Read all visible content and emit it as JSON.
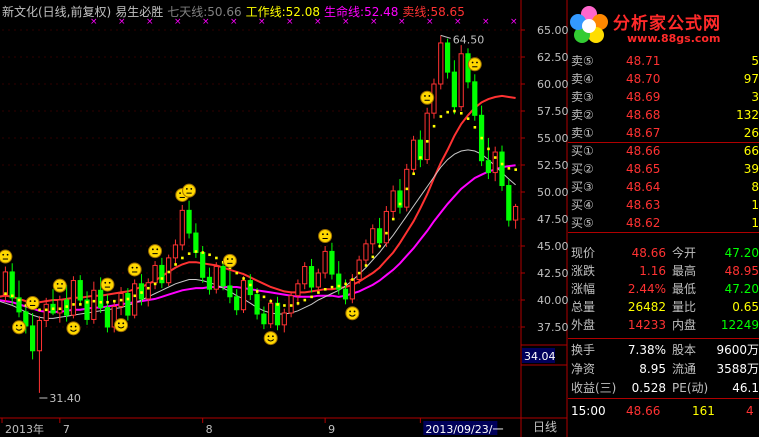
{
  "header": {
    "stock": "新文化(日线,前复权)",
    "indicator": "易生必胜",
    "qitian_label": "七天线:",
    "qitian_value": "50.66",
    "gongzuo_label": "工作线:",
    "gongzuo_value": "52.08",
    "shengming_label": "生命线:",
    "shengming_value": "52.48",
    "maixian_label": "卖线:",
    "maixian_value": "58.65"
  },
  "colors": {
    "up": "#ff3232",
    "down": "#00ff00",
    "gongzuo": "#ffffff",
    "shengming": "#ff00ff",
    "maixian": "#ff3232",
    "dots": "#ffff00",
    "axis": "#b00000"
  },
  "logo": {
    "brand": "分析家公式网",
    "url": "www.88gs.com"
  },
  "chart_data": {
    "type": "candlestick",
    "ylim": [
      34.5,
      66.0
    ],
    "y_ticks": [
      "65.00",
      "62.50",
      "60.00",
      "57.50",
      "55.00",
      "52.50",
      "50.00",
      "47.50",
      "45.00",
      "42.50",
      "40.00",
      "37.50"
    ],
    "x_labels": [
      "2013年",
      "7",
      "8",
      "9",
      "2013/09/23/一"
    ],
    "annotations": {
      "high": "64.50",
      "low": "31.40",
      "cursor_value": "34.04"
    },
    "candles": [
      {
        "o": 40.5,
        "h": 43.1,
        "l": 39.8,
        "c": 42.6
      },
      {
        "o": 42.6,
        "h": 43.4,
        "l": 39.5,
        "c": 40.2
      },
      {
        "o": 40.2,
        "h": 41.8,
        "l": 38.4,
        "c": 38.9
      },
      {
        "o": 38.9,
        "h": 39.6,
        "l": 36.9,
        "c": 37.6
      },
      {
        "o": 37.6,
        "h": 38.8,
        "l": 34.5,
        "c": 35.3
      },
      {
        "o": 35.3,
        "h": 38.5,
        "l": 31.4,
        "c": 38.1
      },
      {
        "o": 38.1,
        "h": 40.2,
        "l": 37.5,
        "c": 39.6
      },
      {
        "o": 39.6,
        "h": 41.0,
        "l": 38.6,
        "c": 38.8
      },
      {
        "o": 38.8,
        "h": 40.4,
        "l": 37.9,
        "c": 40.0
      },
      {
        "o": 40.0,
        "h": 41.4,
        "l": 38.0,
        "c": 38.6
      },
      {
        "o": 38.6,
        "h": 42.2,
        "l": 38.3,
        "c": 41.8
      },
      {
        "o": 41.8,
        "h": 42.3,
        "l": 39.6,
        "c": 40.0
      },
      {
        "o": 40.0,
        "h": 40.8,
        "l": 37.7,
        "c": 38.2
      },
      {
        "o": 38.2,
        "h": 41.7,
        "l": 37.8,
        "c": 40.9
      },
      {
        "o": 40.9,
        "h": 42.1,
        "l": 38.8,
        "c": 39.3
      },
      {
        "o": 39.3,
        "h": 40.5,
        "l": 37.0,
        "c": 37.5
      },
      {
        "o": 37.5,
        "h": 39.9,
        "l": 37.0,
        "c": 39.4
      },
      {
        "o": 39.4,
        "h": 41.2,
        "l": 38.6,
        "c": 40.6
      },
      {
        "o": 40.6,
        "h": 41.1,
        "l": 38.1,
        "c": 38.6
      },
      {
        "o": 38.6,
        "h": 41.9,
        "l": 38.3,
        "c": 41.5
      },
      {
        "o": 41.5,
        "h": 42.4,
        "l": 39.5,
        "c": 40.1
      },
      {
        "o": 40.1,
        "h": 42.0,
        "l": 39.4,
        "c": 41.6
      },
      {
        "o": 41.6,
        "h": 43.6,
        "l": 41.0,
        "c": 43.2
      },
      {
        "o": 43.2,
        "h": 43.9,
        "l": 41.1,
        "c": 41.6
      },
      {
        "o": 41.6,
        "h": 44.2,
        "l": 41.3,
        "c": 43.9
      },
      {
        "o": 43.9,
        "h": 45.6,
        "l": 43.2,
        "c": 45.1
      },
      {
        "o": 45.1,
        "h": 48.8,
        "l": 44.6,
        "c": 48.3
      },
      {
        "o": 48.3,
        "h": 49.2,
        "l": 45.7,
        "c": 46.2
      },
      {
        "o": 46.2,
        "h": 47.1,
        "l": 43.9,
        "c": 44.4
      },
      {
        "o": 44.4,
        "h": 45.0,
        "l": 41.6,
        "c": 42.1
      },
      {
        "o": 42.1,
        "h": 43.0,
        "l": 40.5,
        "c": 41.0
      },
      {
        "o": 41.0,
        "h": 43.5,
        "l": 40.6,
        "c": 43.1
      },
      {
        "o": 43.1,
        "h": 43.6,
        "l": 40.9,
        "c": 41.3
      },
      {
        "o": 41.3,
        "h": 42.7,
        "l": 39.7,
        "c": 40.3
      },
      {
        "o": 40.3,
        "h": 41.0,
        "l": 38.6,
        "c": 39.1
      },
      {
        "o": 39.1,
        "h": 42.2,
        "l": 38.8,
        "c": 41.8
      },
      {
        "o": 41.8,
        "h": 42.4,
        "l": 40.0,
        "c": 40.5
      },
      {
        "o": 40.5,
        "h": 41.1,
        "l": 38.2,
        "c": 38.7
      },
      {
        "o": 38.7,
        "h": 39.4,
        "l": 37.3,
        "c": 37.8
      },
      {
        "o": 37.8,
        "h": 40.1,
        "l": 37.4,
        "c": 39.7
      },
      {
        "o": 39.7,
        "h": 40.3,
        "l": 37.2,
        "c": 37.7
      },
      {
        "o": 37.7,
        "h": 39.2,
        "l": 37.0,
        "c": 38.8
      },
      {
        "o": 38.8,
        "h": 40.8,
        "l": 38.4,
        "c": 40.4
      },
      {
        "o": 40.4,
        "h": 41.9,
        "l": 39.5,
        "c": 41.5
      },
      {
        "o": 41.5,
        "h": 43.5,
        "l": 41.0,
        "c": 43.1
      },
      {
        "o": 43.1,
        "h": 43.8,
        "l": 40.7,
        "c": 41.2
      },
      {
        "o": 41.2,
        "h": 42.9,
        "l": 40.9,
        "c": 42.5
      },
      {
        "o": 42.5,
        "h": 45.0,
        "l": 42.0,
        "c": 44.5
      },
      {
        "o": 44.5,
        "h": 45.3,
        "l": 41.9,
        "c": 42.4
      },
      {
        "o": 42.4,
        "h": 43.6,
        "l": 40.5,
        "c": 41.0
      },
      {
        "o": 41.0,
        "h": 41.9,
        "l": 39.6,
        "c": 40.1
      },
      {
        "o": 40.1,
        "h": 42.4,
        "l": 39.7,
        "c": 41.9
      },
      {
        "o": 41.9,
        "h": 44.1,
        "l": 41.5,
        "c": 43.7
      },
      {
        "o": 43.7,
        "h": 45.6,
        "l": 43.1,
        "c": 45.2
      },
      {
        "o": 45.2,
        "h": 47.0,
        "l": 44.3,
        "c": 46.6
      },
      {
        "o": 46.6,
        "h": 47.6,
        "l": 44.8,
        "c": 45.3
      },
      {
        "o": 45.3,
        "h": 48.7,
        "l": 44.9,
        "c": 48.2
      },
      {
        "o": 48.2,
        "h": 50.6,
        "l": 47.6,
        "c": 50.1
      },
      {
        "o": 50.1,
        "h": 51.2,
        "l": 48.0,
        "c": 48.6
      },
      {
        "o": 48.6,
        "h": 52.6,
        "l": 48.2,
        "c": 52.1
      },
      {
        "o": 52.1,
        "h": 55.2,
        "l": 51.6,
        "c": 54.8
      },
      {
        "o": 54.8,
        "h": 55.7,
        "l": 52.3,
        "c": 53.0
      },
      {
        "o": 53.0,
        "h": 57.8,
        "l": 52.6,
        "c": 57.3
      },
      {
        "o": 57.3,
        "h": 60.5,
        "l": 56.8,
        "c": 60.0
      },
      {
        "o": 60.0,
        "h": 64.5,
        "l": 59.5,
        "c": 63.8
      },
      {
        "o": 63.8,
        "h": 64.2,
        "l": 60.5,
        "c": 61.1
      },
      {
        "o": 61.1,
        "h": 62.2,
        "l": 57.2,
        "c": 57.9
      },
      {
        "o": 57.9,
        "h": 63.6,
        "l": 57.5,
        "c": 62.8
      },
      {
        "o": 62.8,
        "h": 63.3,
        "l": 59.6,
        "c": 60.2
      },
      {
        "o": 60.2,
        "h": 60.9,
        "l": 56.6,
        "c": 57.1
      },
      {
        "o": 57.1,
        "h": 58.0,
        "l": 52.4,
        "c": 52.9
      },
      {
        "o": 52.9,
        "h": 55.0,
        "l": 51.2,
        "c": 51.8
      },
      {
        "o": 51.8,
        "h": 54.2,
        "l": 51.0,
        "c": 53.7
      },
      {
        "o": 53.7,
        "h": 54.3,
        "l": 50.1,
        "c": 50.6
      },
      {
        "o": 50.6,
        "h": 51.2,
        "l": 46.8,
        "c": 47.4
      },
      {
        "o": 47.4,
        "h": 48.9,
        "l": 46.6,
        "c": 48.66
      }
    ],
    "series": [
      {
        "name": "卖线",
        "values": [
          40.3,
          40.4,
          40.3,
          40.1,
          39.9,
          39.8,
          39.8,
          39.9,
          40.0,
          40.0,
          40.1,
          40.2,
          40.2,
          40.3,
          40.4,
          40.4,
          40.5,
          40.6,
          40.7,
          40.8,
          41.0,
          41.2,
          41.5,
          41.8,
          42.2,
          42.6,
          43.0,
          43.3,
          43.5,
          43.5,
          43.4,
          43.3,
          43.2,
          43.0,
          42.8,
          42.6,
          42.4,
          42.1,
          41.8,
          41.5,
          41.2,
          41.0,
          40.8,
          40.7,
          40.7,
          40.7,
          40.8,
          40.9,
          41.0,
          41.0,
          41.1,
          41.2,
          41.4,
          41.7,
          42.1,
          42.5,
          43.0,
          43.7,
          44.4,
          45.3,
          46.3,
          47.3,
          48.5,
          49.8,
          51.3,
          52.7,
          53.9,
          55.2,
          56.3,
          57.1,
          57.8,
          58.3,
          58.6,
          58.8,
          58.9,
          58.8,
          58.7
        ]
      },
      {
        "name": "生命线",
        "values": [
          40.0,
          39.9,
          39.8,
          39.6,
          39.4,
          39.2,
          39.0,
          38.9,
          38.9,
          38.9,
          39.0,
          39.1,
          39.1,
          39.2,
          39.3,
          39.3,
          39.4,
          39.5,
          39.6,
          39.7,
          39.8,
          39.9,
          40.0,
          40.1,
          40.3,
          40.5,
          40.7,
          40.9,
          41.0,
          41.1,
          41.1,
          41.2,
          41.2,
          41.2,
          41.2,
          41.2,
          41.1,
          41.0,
          40.9,
          40.8,
          40.7,
          40.6,
          40.5,
          40.4,
          40.3,
          40.3,
          40.3,
          40.4,
          40.4,
          40.4,
          40.3,
          40.4,
          40.6,
          40.8,
          41.1,
          41.4,
          41.8,
          42.3,
          42.8,
          43.4,
          44.1,
          44.8,
          45.6,
          46.4,
          47.3,
          48.1,
          48.9,
          49.6,
          50.3,
          50.8,
          51.3,
          51.6,
          51.9,
          52.1,
          52.3,
          52.4,
          52.48
        ]
      },
      {
        "name": "工作线",
        "values": [
          40.5,
          40.6,
          40.4,
          40.0,
          39.5,
          39.2,
          39.1,
          39.1,
          39.2,
          39.2,
          39.4,
          39.6,
          39.6,
          39.8,
          39.9,
          39.8,
          39.8,
          39.9,
          40.0,
          40.1,
          40.4,
          40.7,
          41.1,
          41.5,
          42.0,
          42.6,
          43.3,
          43.9,
          44.3,
          44.5,
          44.4,
          44.2,
          43.9,
          43.5,
          43.0,
          42.5,
          42.0,
          41.4,
          40.8,
          40.3,
          39.9,
          39.6,
          39.5,
          39.5,
          39.7,
          40.0,
          40.3,
          40.7,
          41.0,
          41.2,
          41.3,
          41.5,
          41.9,
          42.5,
          43.2,
          44.0,
          45.0,
          46.2,
          47.5,
          48.9,
          50.3,
          51.7,
          53.2,
          54.7,
          56.1,
          57.0,
          57.4,
          57.5,
          57.3,
          56.8,
          56.0,
          55.0,
          54.0,
          53.2,
          52.6,
          52.2,
          52.08
        ]
      },
      {
        "name": "七天线",
        "values": [
          39.9,
          39.7,
          39.5,
          39.2,
          38.9,
          38.6,
          38.4,
          38.3,
          38.3,
          38.4,
          38.5,
          38.6,
          38.7,
          38.8,
          38.9,
          39.0,
          39.1,
          39.2,
          39.3,
          39.5,
          39.7,
          40.0,
          40.3,
          40.6,
          40.9,
          41.2,
          41.5,
          41.7,
          41.9,
          41.9,
          41.8,
          41.6,
          41.4,
          41.1,
          40.8,
          40.4,
          40.1,
          39.7,
          39.3,
          39.0,
          38.8,
          38.7,
          38.7,
          38.8,
          39.0,
          39.3,
          39.6,
          40.0,
          40.3,
          40.6,
          40.9,
          41.3,
          41.8,
          42.4,
          43.0,
          43.7,
          44.4,
          45.2,
          46.0,
          46.9,
          47.8,
          48.7,
          49.6,
          50.5,
          51.4,
          52.3,
          53.0,
          53.5,
          53.8,
          53.9,
          53.8,
          53.5,
          53.0,
          52.4,
          51.8,
          51.2,
          50.66
        ]
      }
    ],
    "face_bars": [
      1,
      5,
      9,
      12,
      17,
      21,
      26,
      30,
      34,
      38,
      42,
      47,
      51,
      55,
      69
    ],
    "face_neutral": [
      0,
      4,
      8,
      15,
      19,
      22,
      26,
      27,
      33,
      47,
      62,
      69
    ],
    "x_label_bars": [
      0,
      8,
      29,
      47,
      61
    ]
  },
  "quote": {
    "orderbook": [
      {
        "label": "卖⑤",
        "price": "48.71",
        "vol": "5"
      },
      {
        "label": "卖④",
        "price": "48.70",
        "vol": "97"
      },
      {
        "label": "卖③",
        "price": "48.69",
        "vol": "3"
      },
      {
        "label": "卖②",
        "price": "48.68",
        "vol": "132"
      },
      {
        "label": "卖①",
        "price": "48.67",
        "vol": "26"
      },
      {
        "label": "买①",
        "price": "48.66",
        "vol": "66"
      },
      {
        "label": "买②",
        "price": "48.65",
        "vol": "39"
      },
      {
        "label": "买③",
        "price": "48.64",
        "vol": "8"
      },
      {
        "label": "买④",
        "price": "48.63",
        "vol": "1"
      },
      {
        "label": "买⑤",
        "price": "48.62",
        "vol": "1"
      }
    ],
    "stats": [
      {
        "l1": "现价",
        "v1": "48.66",
        "c1": "#ff3232",
        "l2": "今开",
        "v2": "47.20",
        "c2": "#00ff00"
      },
      {
        "l1": "涨跌",
        "v1": "1.16",
        "c1": "#ff3232",
        "l2": "最高",
        "v2": "48.95",
        "c2": "#ff3232"
      },
      {
        "l1": "涨幅",
        "v1": "2.44%",
        "c1": "#ff3232",
        "l2": "最低",
        "v2": "47.20",
        "c2": "#00ff00"
      },
      {
        "l1": "总量",
        "v1": "26482",
        "c1": "#ffff00",
        "l2": "量比",
        "v2": "0.65",
        "c2": "#ffff00"
      },
      {
        "l1": "外盘",
        "v1": "14233",
        "c1": "#ff3232",
        "l2": "内盘",
        "v2": "12249",
        "c2": "#00ff00"
      }
    ],
    "finance": [
      {
        "l1": "换手",
        "v1": "7.38%",
        "l2": "股本",
        "v2": "9600万"
      },
      {
        "l1": "净资",
        "v1": "8.95",
        "l2": "流通",
        "v2": "3588万"
      },
      {
        "l1": "收益(三)",
        "v1": "0.528",
        "l2": "PE(动)",
        "v2": "46.1"
      }
    ],
    "tick": {
      "time": "15:00",
      "price": "48.66",
      "vol": "161",
      "n": "4"
    },
    "tab": "日线"
  }
}
